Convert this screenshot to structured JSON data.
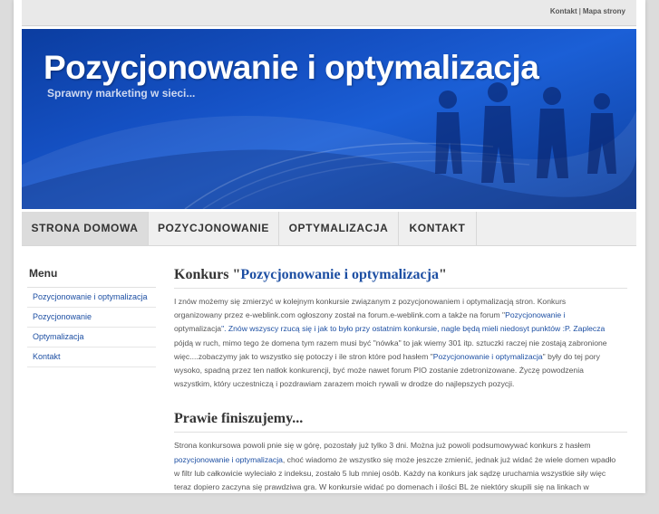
{
  "top_links": {
    "contact": "Kontakt",
    "separator": "|",
    "sitemap": "Mapa strony"
  },
  "header": {
    "title": "Pozycjonowanie i optymalizacja",
    "subtitle": "Sprawny marketing w sieci..."
  },
  "nav": {
    "items": [
      {
        "label": "STRONA DOMOWA"
      },
      {
        "label": "POZYCJONOWANIE"
      },
      {
        "label": "OPTYMALIZACJA"
      },
      {
        "label": "KONTAKT"
      }
    ]
  },
  "sidebar": {
    "title": "Menu",
    "items": [
      {
        "label": "Pozycjonowanie i optymalizacja"
      },
      {
        "label": "Pozycjonowanie"
      },
      {
        "label": "Optymalizacja"
      },
      {
        "label": "Kontakt"
      }
    ]
  },
  "posts": [
    {
      "title_prefix": "Konkurs \"",
      "title_highlight": "Pozycjonowanie i optymalizacja",
      "title_suffix": "\"",
      "lines": [
        [
          "I znów możemy się zmierzyć w kolejnym konkursie związanym z pozycjonowaniem i optymalizacją stron. Konkurs"
        ],
        [
          "organizowany przez e-weblink.com ogłoszony został na forum.e-weblink.com a także na forum \"",
          "Pozycjonowanie i"
        ],
        [
          "optymalizacja",
          "\". Znów wszyscy rzucą się i jak to było przy ostatnim konkursie, nagle będą mieli niedosyt punktów :P. Zaplecza"
        ],
        [
          "pójdą w ruch, mimo tego że domena tym razem musi być \"nówka\" to jak wiemy 301 itp. sztuczki raczej nie zostają zabronione"
        ],
        [
          "więc....zobaczymy jak to wszystko się potoczy i ile stron które pod hasłem \"",
          "Pozycjonowanie i optymalizacja",
          "\" były do tej pory"
        ],
        [
          "wysoko, spadną przez ten natłok konkurencji, być może nawet forum PIO zostanie zdetronizowane. Życzę powodzenia"
        ],
        [
          "wszystkim, który uczestniczą i pozdrawiam zarazem moich rywali w drodze do najlepszych pozycji."
        ]
      ]
    },
    {
      "title_prefix": "Prawie finiszujemy...",
      "title_highlight": "",
      "title_suffix": "",
      "lines": [
        [
          "Strona konkursowa powoli pnie się w górę, pozostały już tylko 3 dni. Można już powoli podsumowywać konkurs z hasłem"
        ],
        [
          "",
          "pozycjonowanie i optymalizacja",
          ", choć wiadomo że wszystko się może jeszcze zmienić, jednak już widać że wiele domen wpadło"
        ],
        [
          "w filtr lub całkowicie wyleciało z indeksu, zostało 5 lub mniej osób. Każdy na konkurs jak sądzę uruchamia wszystkie siły więc"
        ],
        [
          "teraz dopiero zaczyna się prawdziwa gra. W konkursie widać po domenach i ilości BL że niektóry skupili się na linkach w"
        ]
      ]
    }
  ],
  "colors": {
    "banner": "#1551c4",
    "link": "#1d4fa3",
    "nav_active": "#dcdcdc"
  }
}
